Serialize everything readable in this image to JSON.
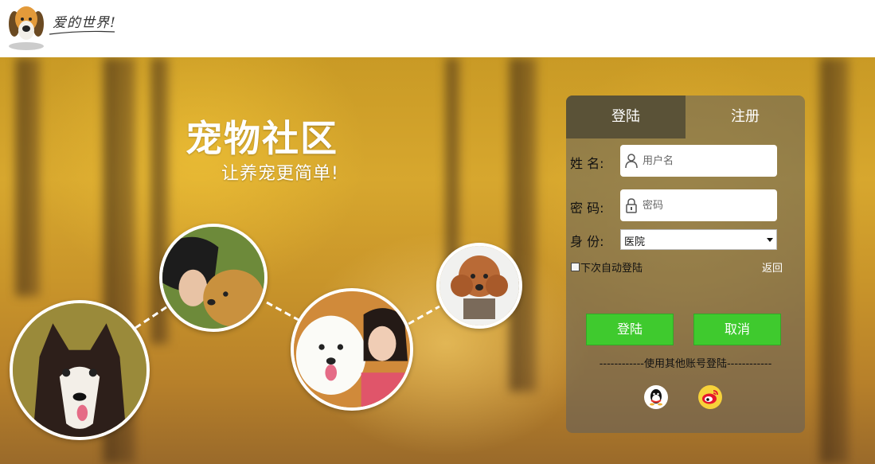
{
  "header": {
    "slogan": "爱的世界!"
  },
  "hero": {
    "title": "宠物社区",
    "subtitle": "让养宠更简单!"
  },
  "login": {
    "tabs": [
      {
        "label": "登陆",
        "active": true
      },
      {
        "label": "注册",
        "active": false
      }
    ],
    "username_label": "姓  名:",
    "username_placeholder": "用户名",
    "password_label": "密  码:",
    "password_placeholder": "密码",
    "role_label": "身  份:",
    "role_value": "医院",
    "remember_label": "下次自动登陆",
    "back_label": "返回",
    "login_button": "登陆",
    "cancel_button": "取消",
    "other_accounts": "------------使用其他账号登陆------------",
    "social": [
      {
        "icon": "qq-icon"
      },
      {
        "icon": "weibo-icon"
      }
    ]
  },
  "colors": {
    "active_tab": "#5a5237",
    "button_green": "#3fca2e"
  }
}
